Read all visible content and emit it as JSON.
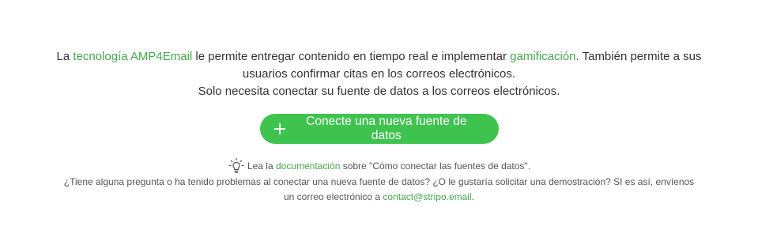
{
  "intro": {
    "text1": "La ",
    "link_tech": "tecnología AMP4Email",
    "text2": " le permite entregar contenido en tiempo real e implementar ",
    "link_gamification": "gamificación",
    "text3": ". También permite a sus",
    "line2": "usuarios confirmar citas en los correos electrónicos.",
    "line3": "Solo necesita conectar su fuente de datos a los correos electrónicos."
  },
  "cta": {
    "label": "Conecte una nueva fuente de datos",
    "icon": "plus-icon",
    "color": "#3fc34f"
  },
  "help": {
    "icon": "lightbulb-icon",
    "read_prefix": "Lea la ",
    "doc_link": "documentación",
    "read_suffix": " sobre \"Cómo conectar las fuentes de datos\".",
    "question_line": "¿Tiene alguna pregunta o ha tenido problemas al conectar una nueva fuente de datos? ¿O le gustaría solicitar una demostración? SI es así, envíenos",
    "email_prefix": "un correo electrónico a ",
    "email_link": "contact@stripo.email",
    "email_suffix": "."
  },
  "colors": {
    "link": "#46a54d",
    "text": "#333333"
  }
}
